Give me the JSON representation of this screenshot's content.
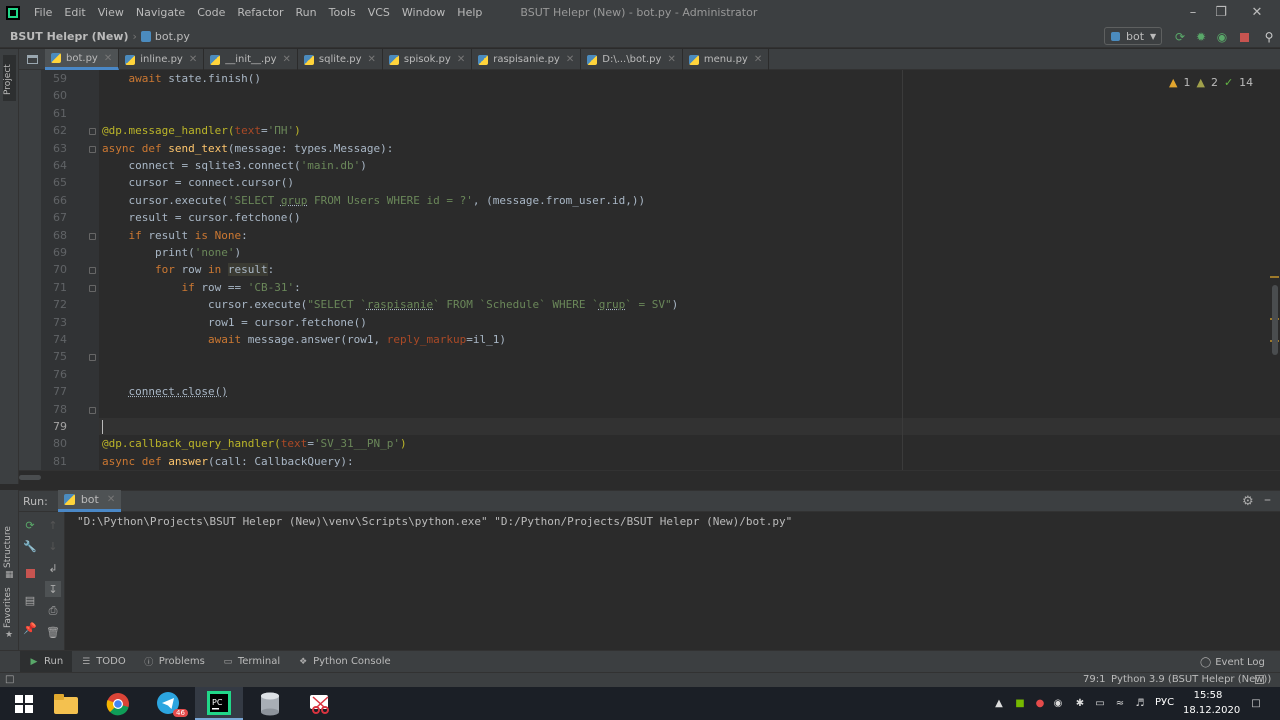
{
  "menubar": {
    "items": [
      "File",
      "Edit",
      "View",
      "Navigate",
      "Code",
      "Refactor",
      "Run",
      "Tools",
      "VCS",
      "Window",
      "Help"
    ],
    "window_title": "BSUT Helepr (New) - bot.py - Administrator"
  },
  "navbar": {
    "project": "BSUT Helepr (New)",
    "separator": "›",
    "file": "bot.py",
    "run_config": "bot"
  },
  "left_strip": {
    "project_tab": "Project"
  },
  "tabs": [
    {
      "label": "bot.py",
      "active": true
    },
    {
      "label": "inline.py"
    },
    {
      "label": "__init__.py"
    },
    {
      "label": "sqlite.py"
    },
    {
      "label": "spisok.py"
    },
    {
      "label": "raspisanie.py"
    },
    {
      "label": "D:\\...\\bot.py"
    },
    {
      "label": "menu.py"
    }
  ],
  "inspections": {
    "warnings": "1",
    "weak_warnings": "2",
    "typos": "14"
  },
  "code": {
    "line_numbers": [
      "59",
      "60",
      "61",
      "62",
      "63",
      "64",
      "65",
      "66",
      "67",
      "68",
      "69",
      "70",
      "71",
      "72",
      "73",
      "74",
      "75",
      "76",
      "77",
      "78",
      "79",
      "80",
      "81"
    ],
    "l59_a": "    ",
    "l59_kw": "await",
    "l59_b": " state.finish()",
    "l62_dec": "@dp.message_handler(",
    "l62_prm": "text",
    "l62_eq": "=",
    "l62_str": "'ПН'",
    "l62_end": ")",
    "l63_kw": "async def ",
    "l63_fn": "send_text",
    "l63_b": "(message: types.Message):",
    "l64_a": "    connect = sqlite3.connect(",
    "l64_str": "'main.db'",
    "l64_b": ")",
    "l65": "    cursor = connect.cursor()",
    "l66_a": "    cursor.execute(",
    "l66_s1": "'SELECT ",
    "l66_s2": "grup",
    "l66_s3": " FROM Users WHERE id = ?'",
    "l66_b": ", (message.from_user.id,))",
    "l67": "    result = cursor.fetchone()",
    "l68_a": "    ",
    "l68_kw1": "if",
    "l68_b": " result ",
    "l68_kw2": "is None",
    "l68_c": ":",
    "l69_a": "        print(",
    "l69_str": "'none'",
    "l69_b": ")",
    "l70_a": "        ",
    "l70_kw1": "for",
    "l70_b": " row ",
    "l70_kw2": "in",
    "l70_c": " ",
    "l70_hl": "result",
    "l70_d": ":",
    "l71_a": "            ",
    "l71_kw": "if",
    "l71_b": " row == ",
    "l71_str": "'CB-31'",
    "l71_c": ":",
    "l72_a": "                cursor.execute(",
    "l72_s1": "\"SELECT `",
    "l72_s2": "raspisanie",
    "l72_s3": "` FROM `Schedule` WHERE `",
    "l72_s4": "grup",
    "l72_s5": "` = SV\"",
    "l72_b": ")",
    "l73": "                row1 = cursor.fetchone()",
    "l74_a": "                ",
    "l74_kw": "await",
    "l74_b": " message.answer(row1, ",
    "l74_prm": "reply_markup",
    "l74_c": "=il_1)",
    "l77_a": "    ",
    "l77_ul": "connect.close()",
    "l80_dec": "@dp.callback_query_handler(",
    "l80_prm": "text",
    "l80_eq": "=",
    "l80_str": "'SV_31__PN_p'",
    "l80_end": ")",
    "l81_kw": "async def ",
    "l81_fn": "answer",
    "l81_b": "(call: CallbackQuery):"
  },
  "run_panel": {
    "label": "Run:",
    "tab": "bot",
    "output": "\"D:\\Python\\Projects\\BSUT Helepr (New)\\venv\\Scripts\\python.exe\" \"D:/Python/Projects/BSUT Helepr (New)/bot.py\""
  },
  "side_labels": {
    "structure": "Structure",
    "favorites": "Favorites"
  },
  "bottom_tabs": [
    {
      "label": "Run",
      "active": true
    },
    {
      "label": "TODO"
    },
    {
      "label": "Problems"
    },
    {
      "label": "Terminal"
    },
    {
      "label": "Python Console"
    }
  ],
  "event_log": "Event Log",
  "status": {
    "position": "79:1",
    "interpreter": "Python 3.9 (BSUT Helepr (New))"
  },
  "taskbar": {
    "telegram_badge": "46",
    "language": "РУС",
    "time": "15:58",
    "date": "18.12.2020"
  },
  "colors": {
    "accent": "#4a88c7",
    "keyword": "#cc7832",
    "string": "#6a8759",
    "decorator": "#bbb529",
    "function": "#ffc66d",
    "param": "#aa4926"
  }
}
